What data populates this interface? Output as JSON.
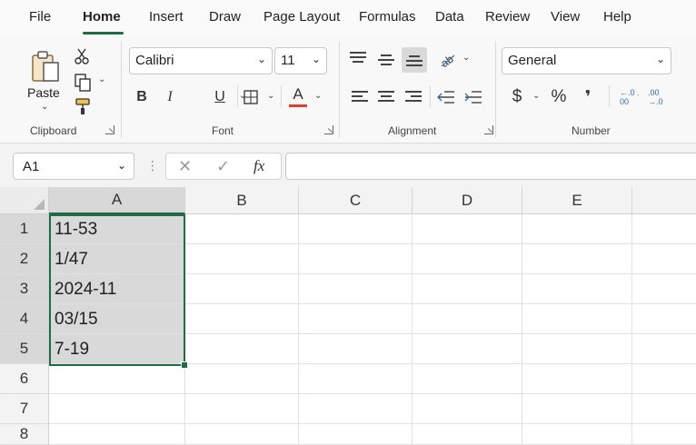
{
  "tabs": [
    "File",
    "Home",
    "Insert",
    "Draw",
    "Page Layout",
    "Formulas",
    "Data",
    "Review",
    "View",
    "Help"
  ],
  "ribbon": {
    "clipboard": {
      "paste_label": "Paste",
      "group_label": "Clipboard"
    },
    "font": {
      "font_name": "Calibri",
      "font_size": "11",
      "bold": "B",
      "italic": "I",
      "underline": "U",
      "font_color_glyph": "A",
      "group_label": "Font",
      "font_color": "#e03c31"
    },
    "alignment": {
      "group_label": "Alignment"
    },
    "number": {
      "format": "General",
      "currency": "$",
      "percent": "%",
      "comma": "❜",
      "increase_decimal": "←.0 .00",
      "decrease_decimal": ".00 →.0",
      "group_label": "Number"
    }
  },
  "formula_bar": {
    "name_box": "A1",
    "cancel_glyph": "✕",
    "enter_glyph": "✓",
    "fx_glyph": "fx",
    "formula": ""
  },
  "grid": {
    "columns": [
      "A",
      "B",
      "C",
      "D",
      "E"
    ],
    "rows": [
      "1",
      "2",
      "3",
      "4",
      "5",
      "6",
      "7",
      "8"
    ],
    "colA": [
      "11-53",
      "1/47",
      "2024-11",
      "03/15",
      "7-19",
      "",
      "",
      ""
    ],
    "selection": "A1:A5",
    "accent": "#1e6b44"
  }
}
